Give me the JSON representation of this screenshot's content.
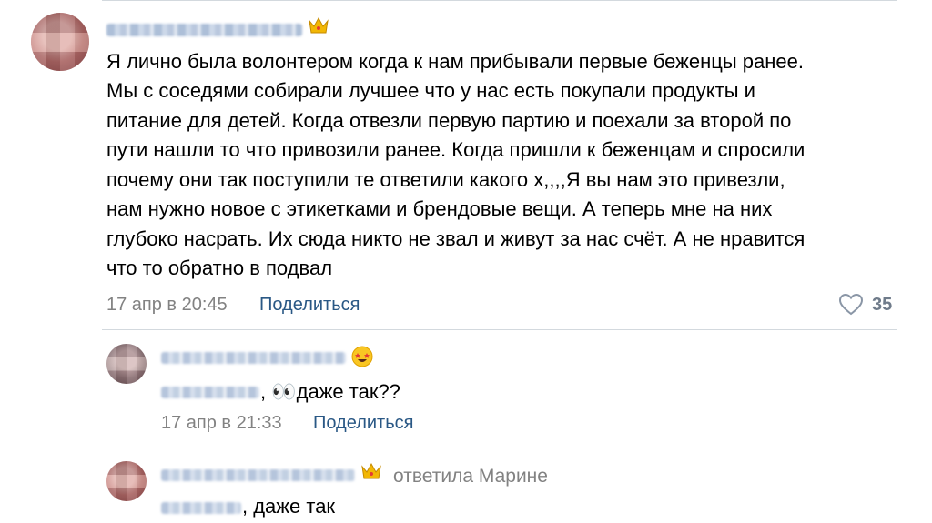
{
  "comment": {
    "text_lines": [
      "Я лично была волонтером когда к нам прибывали первые беженцы ранее.",
      "Мы с соседями собирали лучшее что у нас есть покупали продукты и",
      "питание для детей. Когда отвезли первую партию и поехали за второй по",
      "пути нашли то что привозили ранее. Когда пришли к беженцам и спросили",
      "почему они так поступили те ответили какого х,,,,Я вы нам это привезли,",
      "нам нужно новое с этикетками и брендовые вещи. А теперь мне на них",
      "глубоко насрать. Их сюда никто не звал и живут за нас счёт. А не нравится",
      "что то обратно в подвал"
    ],
    "date": "17 апр в 20:45",
    "share_label": "Поделиться",
    "likes": "35",
    "author_badge_icon": "crown-icon",
    "like_icon": "heart-icon"
  },
  "reply1": {
    "text": ", 👀даже так??",
    "date": "17 апр в 21:33",
    "share_label": "Поделиться",
    "author_badge_icon": "starstruck-emoji-icon"
  },
  "reply2": {
    "replied_to": "ответила Марине",
    "text": ", даже так",
    "author_badge_icon": "crown-icon"
  },
  "colors": {
    "link": "#2a5885",
    "meta": "#828282",
    "divider": "#d3d9de"
  }
}
